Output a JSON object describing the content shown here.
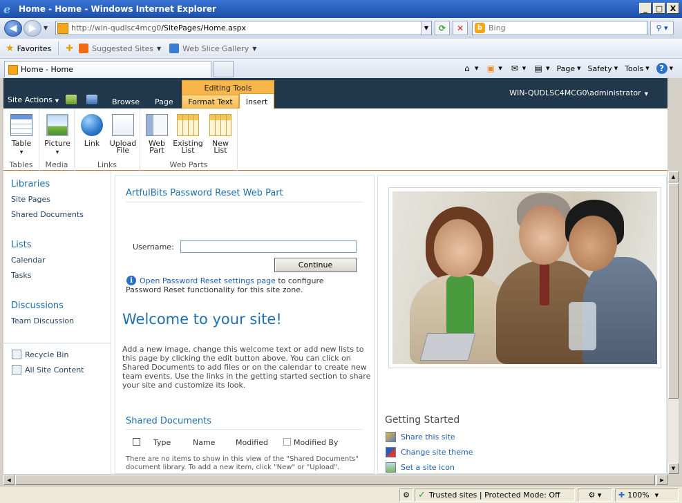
{
  "window": {
    "title": "Home - Home - Windows Internet Explorer",
    "controls": [
      "_",
      "□",
      "X"
    ]
  },
  "addressbar": {
    "url_prefix": "http://win-qudlsc4mcg0",
    "url_path": "/SitePages/Home.aspx",
    "search_placeholder": "Bing"
  },
  "favorites": {
    "label": "Favorites",
    "suggested_sites": "Suggested Sites",
    "web_slice_gallery": "Web Slice Gallery"
  },
  "tabs": {
    "active": "Home - Home"
  },
  "commandbar": {
    "page": "Page",
    "safety": "Safety",
    "tools": "Tools"
  },
  "sharepoint": {
    "site_actions": "Site Actions",
    "tabs": {
      "browse": "Browse",
      "page": "Page",
      "editing_tools": "Editing Tools",
      "format_text": "Format Text",
      "insert": "Insert"
    },
    "user": "WIN-QUDLSC4MCG0\\administrator"
  },
  "ribbon": {
    "groups": {
      "tables": "Tables",
      "media": "Media",
      "links": "Links",
      "web_parts": "Web Parts"
    },
    "buttons": {
      "table": "Table",
      "picture": "Picture",
      "link": "Link",
      "upload_file_1": "Upload",
      "upload_file_2": "File",
      "web_part_1": "Web",
      "web_part_2": "Part",
      "existing_list_1": "Existing",
      "existing_list_2": "List",
      "new_list_1": "New",
      "new_list_2": "List"
    }
  },
  "quicklaunch": {
    "libraries": "Libraries",
    "site_pages": "Site Pages",
    "shared_documents": "Shared Documents",
    "lists": "Lists",
    "calendar": "Calendar",
    "tasks": "Tasks",
    "discussions": "Discussions",
    "team_discussion": "Team Discussion",
    "recycle_bin": "Recycle Bin",
    "all_site_content": "All Site Content"
  },
  "webpart": {
    "title": "ArtfulBits Password Reset Web Part",
    "username_label": "Username:",
    "continue": "Continue",
    "info_link": "Open Password Reset settings page",
    "info_rest": " to configure Password Reset functionality for this site zone."
  },
  "welcome": {
    "title": "Welcome to your site!",
    "body": "Add a new image, change this welcome text or add new lists to this page by clicking the edit button above. You can click on Shared Documents to add files or on the calendar to create new team events. Use the links in the getting started section to share your site and customize its look."
  },
  "shared_docs": {
    "title": "Shared Documents",
    "columns": [
      "Type",
      "Name",
      "Modified",
      "Modified By"
    ],
    "empty": "There are no items to show in this view of the \"Shared Documents\" document library. To add a new item, click \"New\" or \"Upload\"."
  },
  "getting_started": {
    "title": "Getting Started",
    "share": "Share this site",
    "theme": "Change site theme",
    "icon": "Set a site icon"
  },
  "statusbar": {
    "zone": "Trusted sites | Protected Mode: Off",
    "zoom": "100%"
  }
}
